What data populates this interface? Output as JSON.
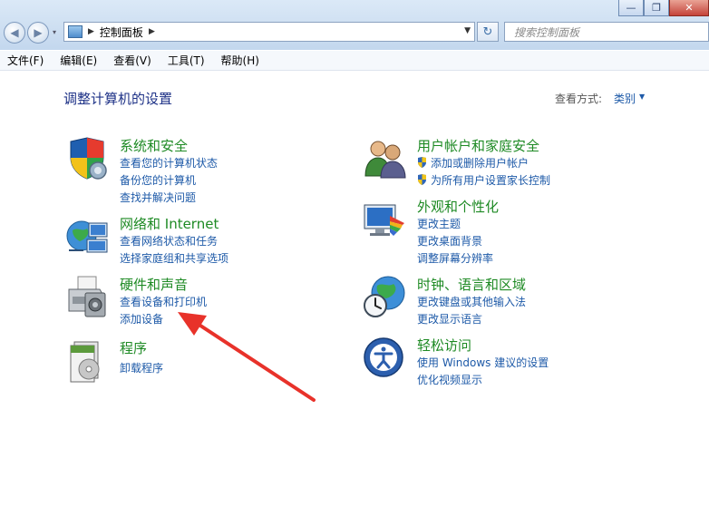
{
  "window": {
    "minimize_glyph": "—",
    "restore_glyph": "❐",
    "close_glyph": "✕"
  },
  "nav": {
    "back_glyph": "◀",
    "forward_glyph": "▶",
    "dropdown_glyph": "▾"
  },
  "address": {
    "separator": "▶",
    "path": "控制面板",
    "trail_separator": "▶",
    "dropdown_glyph": "▼"
  },
  "refresh_glyph": "↻",
  "search": {
    "placeholder": "搜索控制面板"
  },
  "menu": [
    "文件(F)",
    "编辑(E)",
    "查看(V)",
    "工具(T)",
    "帮助(H)"
  ],
  "page_title": "调整计算机的设置",
  "view_by": {
    "label": "查看方式:",
    "value": "类别",
    "dropdown_glyph": "▼"
  },
  "categories": {
    "system_security": {
      "title": "系统和安全",
      "links": [
        "查看您的计算机状态",
        "备份您的计算机",
        "查找并解决问题"
      ]
    },
    "network": {
      "title": "网络和 Internet",
      "links": [
        "查看网络状态和任务",
        "选择家庭组和共享选项"
      ]
    },
    "hardware": {
      "title": "硬件和声音",
      "links": [
        "查看设备和打印机",
        "添加设备"
      ]
    },
    "programs": {
      "title": "程序",
      "links": [
        "卸载程序"
      ]
    },
    "user_accounts": {
      "title": "用户帐户和家庭安全",
      "links": [
        "添加或删除用户帐户",
        "为所有用户设置家长控制"
      ]
    },
    "appearance": {
      "title": "外观和个性化",
      "links": [
        "更改主题",
        "更改桌面背景",
        "调整屏幕分辨率"
      ]
    },
    "clock": {
      "title": "时钟、语言和区域",
      "links": [
        "更改键盘或其他输入法",
        "更改显示语言"
      ]
    },
    "ease": {
      "title": "轻松访问",
      "links": [
        "使用 Windows 建议的设置",
        "优化视频显示"
      ]
    }
  },
  "colors": {
    "title_green": "#1e8a24",
    "link_blue": "#1e5aa8",
    "heading_blue": "#1e3287",
    "arrow_red": "#e8322a"
  }
}
